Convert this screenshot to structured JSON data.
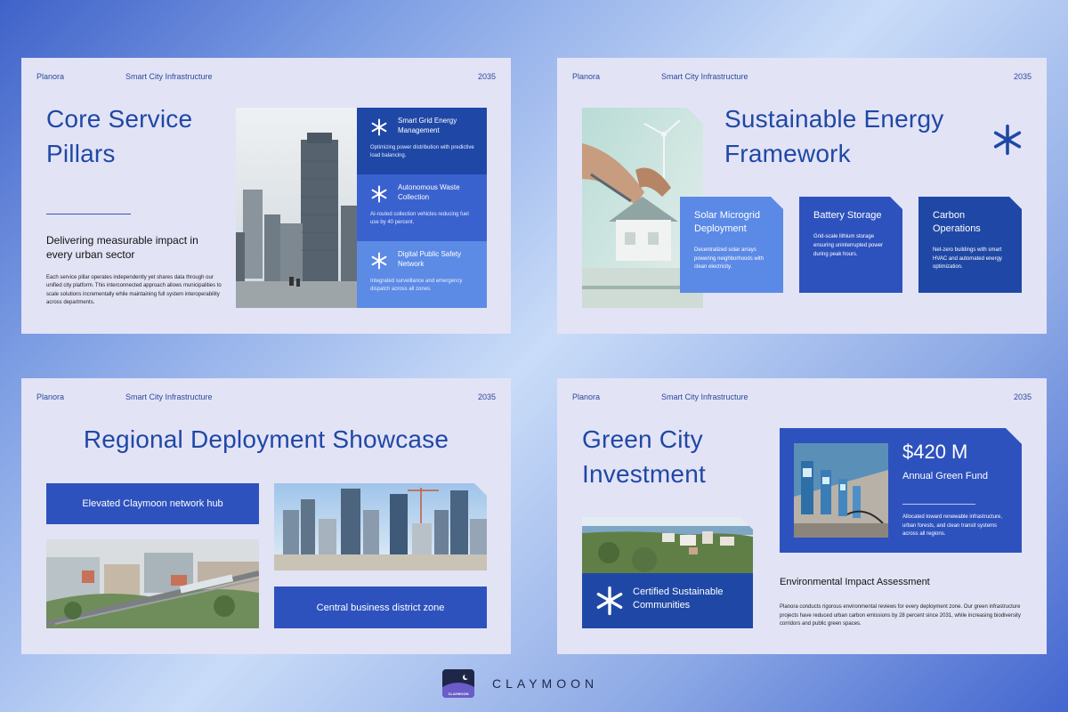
{
  "common": {
    "brand": "Planora",
    "topic": "Smart City Infrastructure",
    "year": "2035"
  },
  "slide1": {
    "title": "Core Service Pillars",
    "subheading": "Delivering measurable impact in every urban sector",
    "body": "Each service pillar operates independently yet shares data through our unified city platform. This interconnected approach allows municipalities to scale solutions incrementally while maintaining full system interoperability across departments.",
    "pillars": [
      {
        "title": "Smart Grid Energy Management",
        "desc": "Optimizing power distribution with predictive load balancing.",
        "color": "#1f48a6"
      },
      {
        "title": "Autonomous Waste Collection",
        "desc": "AI-routed collection vehicles reducing fuel use by 40 percent.",
        "color": "#3a62cf"
      },
      {
        "title": "Digital Public Safety Network",
        "desc": "Integrated surveillance and emergency dispatch across all zones.",
        "color": "#5c8be6"
      }
    ]
  },
  "slide2": {
    "title": "Sustainable Energy Framework",
    "cards": [
      {
        "title": "Solar Microgrid Deployment",
        "desc": "Decentralized solar arrays powering neighborhoods with clean electricity.",
        "color": "#5b8ae6"
      },
      {
        "title": "Battery Storage",
        "desc": "Grid-scale lithium storage ensuring uninterrupted power during peak hours.",
        "color": "#2e52bd"
      },
      {
        "title": "Carbon Operations",
        "desc": "Net-zero buildings with smart HVAC and automated energy optimization.",
        "color": "#1f48a6"
      }
    ]
  },
  "slide3": {
    "title": "Regional Deployment Showcase",
    "hub_label": "Elevated Claymoon network hub",
    "cbd_label": "Central business district zone"
  },
  "slide4": {
    "title": "Green City Investment",
    "amount": "$420 M",
    "amount_label": "Annual Green Fund",
    "fund_desc": "Allocated toward renewable infrastructure, urban forests, and clean transit systems across all regions.",
    "certified": "Certified Sustainable Communities",
    "env_heading": "Environmental Impact Assessment",
    "env_body": "Planora conducts rigorous environmental reviews for every deployment zone. Our green infrastructure projects have reduced urban carbon emissions by 28 percent since 2031, while increasing biodiversity corridors and public green spaces."
  },
  "footer": {
    "logo_text": "CLAYMOON",
    "brand_name": "CLAYMOON"
  }
}
